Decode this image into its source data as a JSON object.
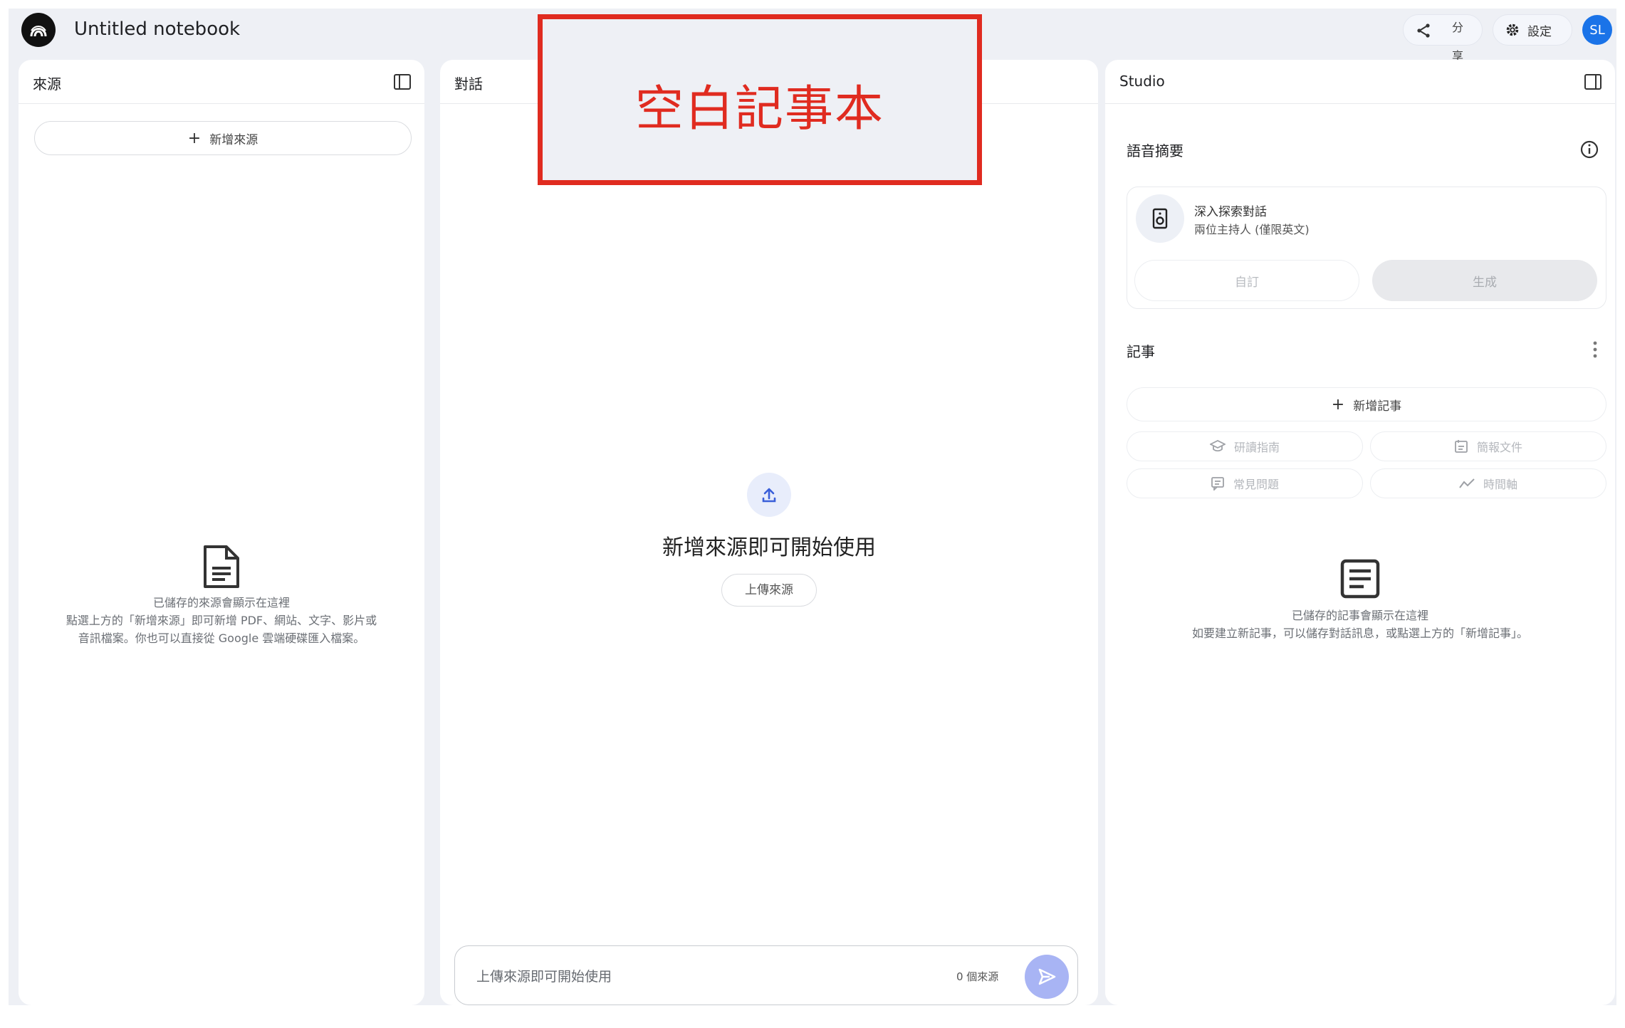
{
  "header": {
    "title": "Untitled notebook",
    "share_label": "分享",
    "settings_label": "設定",
    "avatar_initials": "SL"
  },
  "sources": {
    "title": "來源",
    "add_button": "新增來源",
    "empty_line1": "已儲存的來源會顯示在這裡",
    "empty_line2": "點選上方的「新增來源」即可新增 PDF、網站、文字、影片或",
    "empty_line3": "音訊檔案。你也可以直接從 Google 雲端硬碟匯入檔案。"
  },
  "chat": {
    "title": "對話",
    "empty_heading": "新增來源即可開始使用",
    "upload_button": "上傳來源",
    "input_placeholder": "上傳來源即可開始使用",
    "source_count": "0 個來源"
  },
  "annotation": {
    "text": "空白記事本"
  },
  "studio": {
    "title": "Studio",
    "audio_section": "語音摘要",
    "audio_card_title": "深入探索對話",
    "audio_card_subtitle": "兩位主持人 (僅限英文)",
    "customize_button": "自訂",
    "generate_button": "生成",
    "notes_section": "記事",
    "add_note_button": "新增記事",
    "chips": [
      "研讀指南",
      "簡報文件",
      "常見問題",
      "時間軸"
    ],
    "notes_empty_line1": "已儲存的記事會顯示在這裡",
    "notes_empty_line2": "如要建立新記事，可以儲存對話訊息，或點選上方的「新增記事」。"
  },
  "colors": {
    "accent": "#1a73e8",
    "send_button": "#a8b4f4",
    "annotation_red": "#e02b20"
  }
}
